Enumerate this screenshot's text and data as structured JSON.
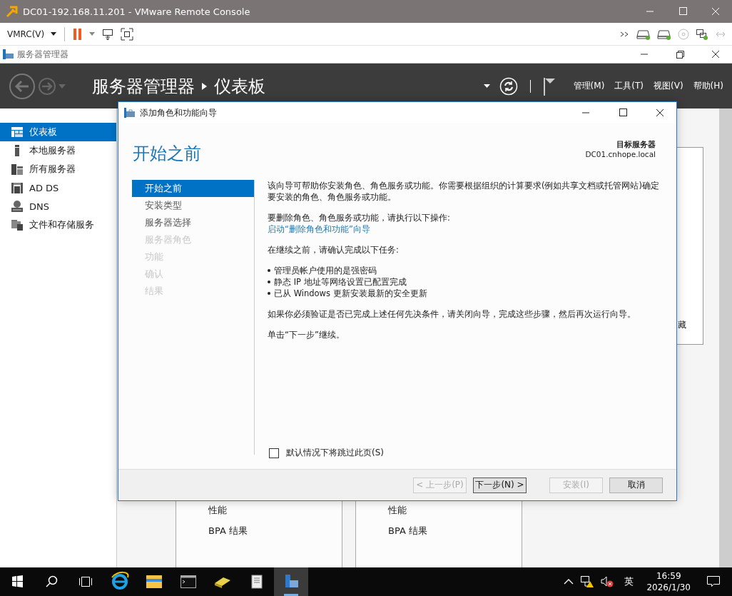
{
  "window": {
    "title": "DC01-192.168.11.201 - VMware Remote Console"
  },
  "vmrc_toolbar": {
    "menu": "VMRC(V)"
  },
  "app": {
    "title": "服务器管理器"
  },
  "header": {
    "breadcrumb": [
      "服务器管理器",
      "仪表板"
    ],
    "menus": [
      "管理(M)",
      "工具(T)",
      "视图(V)",
      "帮助(H)"
    ]
  },
  "sidebar": {
    "items": [
      {
        "label": "仪表板",
        "selected": true,
        "kind": "dashboard"
      },
      {
        "label": "本地服务器",
        "selected": false,
        "kind": "local"
      },
      {
        "label": "所有服务器",
        "selected": false,
        "kind": "all"
      },
      {
        "label": "AD DS",
        "selected": false,
        "kind": "adds"
      },
      {
        "label": "DNS",
        "selected": false,
        "kind": "dns"
      },
      {
        "label": "文件和存储服务",
        "selected": false,
        "kind": "files"
      }
    ]
  },
  "tiles": [
    {
      "rows": [
        "性能",
        "BPA 结果"
      ]
    },
    {
      "rows": [
        "性能",
        "BPA 结果"
      ]
    }
  ],
  "side_tile": {
    "text": "藏"
  },
  "dialog": {
    "title": "添加角色和功能向导",
    "heading": "开始之前",
    "target_label": "目标服务器",
    "target_server": "DC01.cnhope.local",
    "steps": [
      {
        "label": "开始之前",
        "selected": true,
        "disabled": false
      },
      {
        "label": "安装类型",
        "selected": false,
        "disabled": false
      },
      {
        "label": "服务器选择",
        "selected": false,
        "disabled": false
      },
      {
        "label": "服务器角色",
        "selected": false,
        "disabled": true
      },
      {
        "label": "功能",
        "selected": false,
        "disabled": true
      },
      {
        "label": "确认",
        "selected": false,
        "disabled": true
      },
      {
        "label": "结果",
        "selected": false,
        "disabled": true
      }
    ],
    "blocks": [
      [
        {
          "kind": "text",
          "text": "该向导可帮助你安装角色、角色服务或功能。你需要根据组织的计算要求(例如共享文档或托管网站)确定要安装的角色、角色服务或功能。"
        }
      ],
      [
        {
          "kind": "text",
          "text": "要删除角色、角色服务或功能，请执行以下操作:"
        },
        {
          "kind": "link",
          "text": "启动“删除角色和功能”向导"
        }
      ],
      [
        {
          "kind": "text",
          "text": "在继续之前，请确认完成以下任务:"
        }
      ],
      [
        {
          "kind": "bullet",
          "text": "管理员帐户使用的是强密码"
        },
        {
          "kind": "bullet",
          "text": "静态 IP 地址等网络设置已配置完成"
        },
        {
          "kind": "bullet",
          "text": "已从 Windows 更新安装最新的安全更新"
        }
      ],
      [
        {
          "kind": "text",
          "text": "如果你必须验证是否已完成上述任何先决条件，请关闭向导，完成这些步骤，然后再次运行向导。"
        }
      ],
      [
        {
          "kind": "text",
          "text": "单击“下一步”继续。"
        }
      ]
    ],
    "skip_checkbox": {
      "label": "默认情况下将跳过此页(S)",
      "checked": false
    },
    "buttons": [
      {
        "label": "< 上一步(P)",
        "disabled": true,
        "focused": false
      },
      {
        "label": "下一步(N) >",
        "disabled": false,
        "focused": true
      },
      {
        "label": "安装(I)",
        "disabled": true,
        "focused": false
      },
      {
        "label": "取消",
        "disabled": false,
        "focused": false
      }
    ]
  },
  "taskbar": {
    "ime": "英",
    "time": "16:59",
    "date": "2026/1/30"
  }
}
